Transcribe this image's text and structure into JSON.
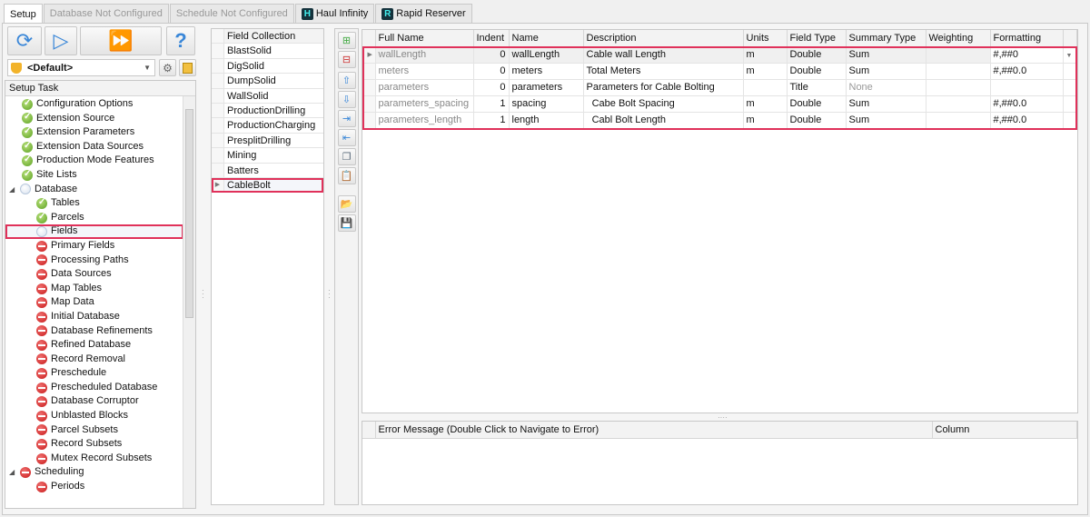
{
  "tabs": [
    {
      "label": "Setup",
      "state": "active"
    },
    {
      "label": "Database Not Configured",
      "state": "disabled"
    },
    {
      "label": "Schedule Not Configured",
      "state": "disabled"
    },
    {
      "label": "Haul Infinity",
      "state": "brand",
      "logo": "H"
    },
    {
      "label": "Rapid Reserver",
      "state": "brand",
      "logo": "R"
    }
  ],
  "toolbar": {
    "refresh_icon": "refresh-icon",
    "run_icon": "play-icon",
    "run_all_icon": "fast-forward-icon",
    "help": "?"
  },
  "profile": {
    "value": "<Default>"
  },
  "setup_task": {
    "header": "Setup Task",
    "items": [
      {
        "label": "Configuration Options",
        "status": "ok",
        "level": 1
      },
      {
        "label": "Extension Source",
        "status": "ok",
        "level": 1
      },
      {
        "label": "Extension Parameters",
        "status": "ok",
        "level": 1
      },
      {
        "label": "Extension Data Sources",
        "status": "ok",
        "level": 1
      },
      {
        "label": "Production Mode Features",
        "status": "ok",
        "level": 1
      },
      {
        "label": "Site Lists",
        "status": "ok",
        "level": 1
      },
      {
        "label": "Database",
        "status": "pend",
        "level": 0,
        "expander": true
      },
      {
        "label": "Tables",
        "status": "ok",
        "level": 2
      },
      {
        "label": "Parcels",
        "status": "ok",
        "level": 2
      },
      {
        "label": "Fields",
        "status": "pend",
        "level": 2,
        "selected": true
      },
      {
        "label": "Primary Fields",
        "status": "no",
        "level": 2
      },
      {
        "label": "Processing Paths",
        "status": "no",
        "level": 2
      },
      {
        "label": "Data Sources",
        "status": "no",
        "level": 2
      },
      {
        "label": "Map Tables",
        "status": "no",
        "level": 2
      },
      {
        "label": "Map Data",
        "status": "no",
        "level": 2
      },
      {
        "label": "Initial Database",
        "status": "no",
        "level": 2
      },
      {
        "label": "Database Refinements",
        "status": "no",
        "level": 2
      },
      {
        "label": "Refined Database",
        "status": "no",
        "level": 2
      },
      {
        "label": "Record Removal",
        "status": "no",
        "level": 2
      },
      {
        "label": "Preschedule",
        "status": "no",
        "level": 2
      },
      {
        "label": "Prescheduled Database",
        "status": "no",
        "level": 2
      },
      {
        "label": "Database Corruptor",
        "status": "no",
        "level": 2
      },
      {
        "label": "Unblasted Blocks",
        "status": "no",
        "level": 2
      },
      {
        "label": "Parcel Subsets",
        "status": "no",
        "level": 2
      },
      {
        "label": "Record Subsets",
        "status": "no",
        "level": 2
      },
      {
        "label": "Mutex Record Subsets",
        "status": "no",
        "level": 2
      },
      {
        "label": "Scheduling",
        "status": "no",
        "level": 0,
        "expander": true
      },
      {
        "label": "Periods",
        "status": "no",
        "level": 2
      }
    ]
  },
  "field_collection": {
    "header": "Field Collection",
    "items": [
      "BlastSolid",
      "DigSolid",
      "DumpSolid",
      "WallSolid",
      "ProductionDrilling",
      "ProductionCharging",
      "PresplitDrilling",
      "Mining",
      "Batters",
      "CableBolt"
    ],
    "selected": "CableBolt"
  },
  "fields_grid": {
    "columns": [
      "Full Name",
      "Indent",
      "Name",
      "Description",
      "Units",
      "Field Type",
      "Summary Type",
      "Weighting",
      "Formatting"
    ],
    "rows": [
      [
        "wallLength",
        "0",
        "wallLength",
        "Cable wall Length",
        "m",
        "Double",
        "Sum",
        "",
        "#,##0"
      ],
      [
        "meters",
        "0",
        "meters",
        "Total Meters",
        "m",
        "Double",
        "Sum",
        "",
        "#,##0.0"
      ],
      [
        "parameters",
        "0",
        "parameters",
        "Parameters for Cable Bolting",
        "",
        "Title",
        "None",
        "",
        ""
      ],
      [
        "parameters_spacing",
        "1",
        "spacing",
        "  Cabe Bolt Spacing",
        "m",
        "Double",
        "Sum",
        "",
        "#,##0.0"
      ],
      [
        "parameters_length",
        "1",
        "length",
        "  Cabl Bolt Length",
        "m",
        "Double",
        "Sum",
        "",
        "#,##0.0"
      ]
    ]
  },
  "error_grid": {
    "columns": [
      "Error Message (Double Click to Navigate to Error)",
      "Column"
    ]
  },
  "colors": {
    "highlight": "#e0315a",
    "accent": "#3a87d8"
  }
}
